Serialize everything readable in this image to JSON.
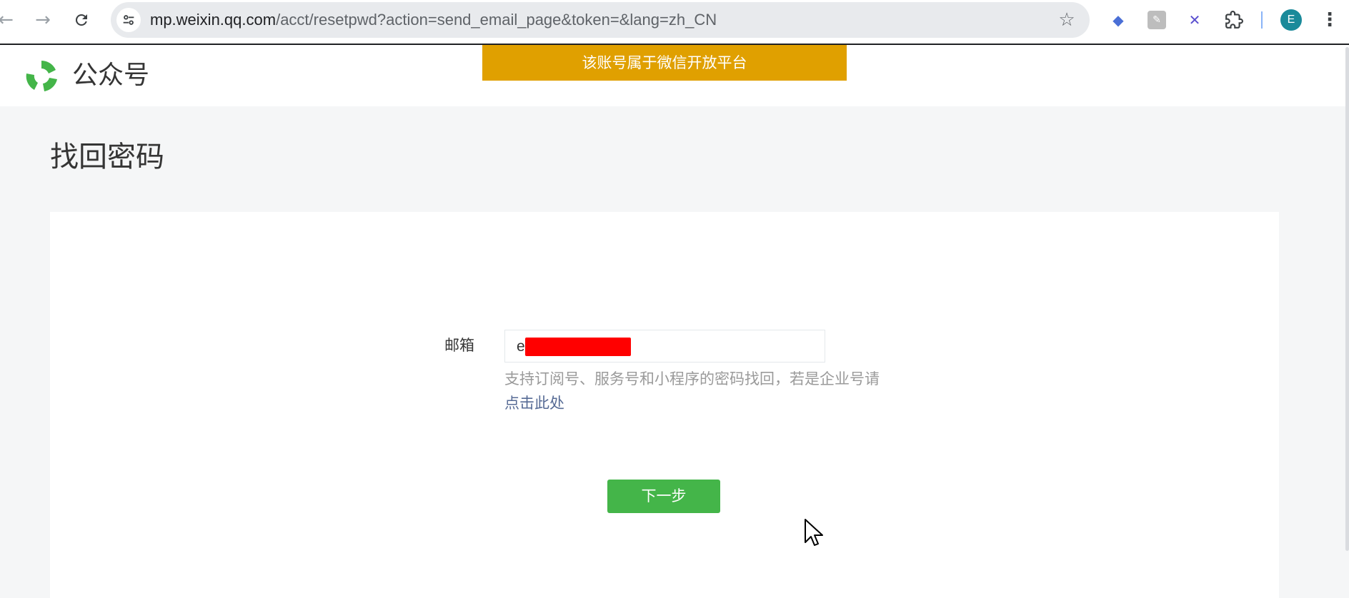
{
  "browser": {
    "url_host": "mp.weixin.qq.com",
    "url_path": "/acct/resetpwd?action=send_email_page&token=&lang=zh_CN",
    "profile_initial": "E",
    "icons": {
      "back": "arrow-left-icon",
      "forward": "arrow-right-icon",
      "reload": "reload-icon",
      "site_info": "tune-icon",
      "bookmark": "star-icon",
      "extensions": "puzzle-icon",
      "menu": "kebab-menu-icon"
    }
  },
  "header": {
    "logo_text": "公众号",
    "notice": "该账号属于微信开放平台",
    "brand_color": "#44b549",
    "notice_color": "#e0a000"
  },
  "main": {
    "title": "找回密码",
    "email_label": "邮箱",
    "email_value_visible": "e",
    "help_text": "支持订阅号、服务号和小程序的密码找回，若是企业号请",
    "help_link": "点击此处",
    "next_button": "下一步"
  }
}
